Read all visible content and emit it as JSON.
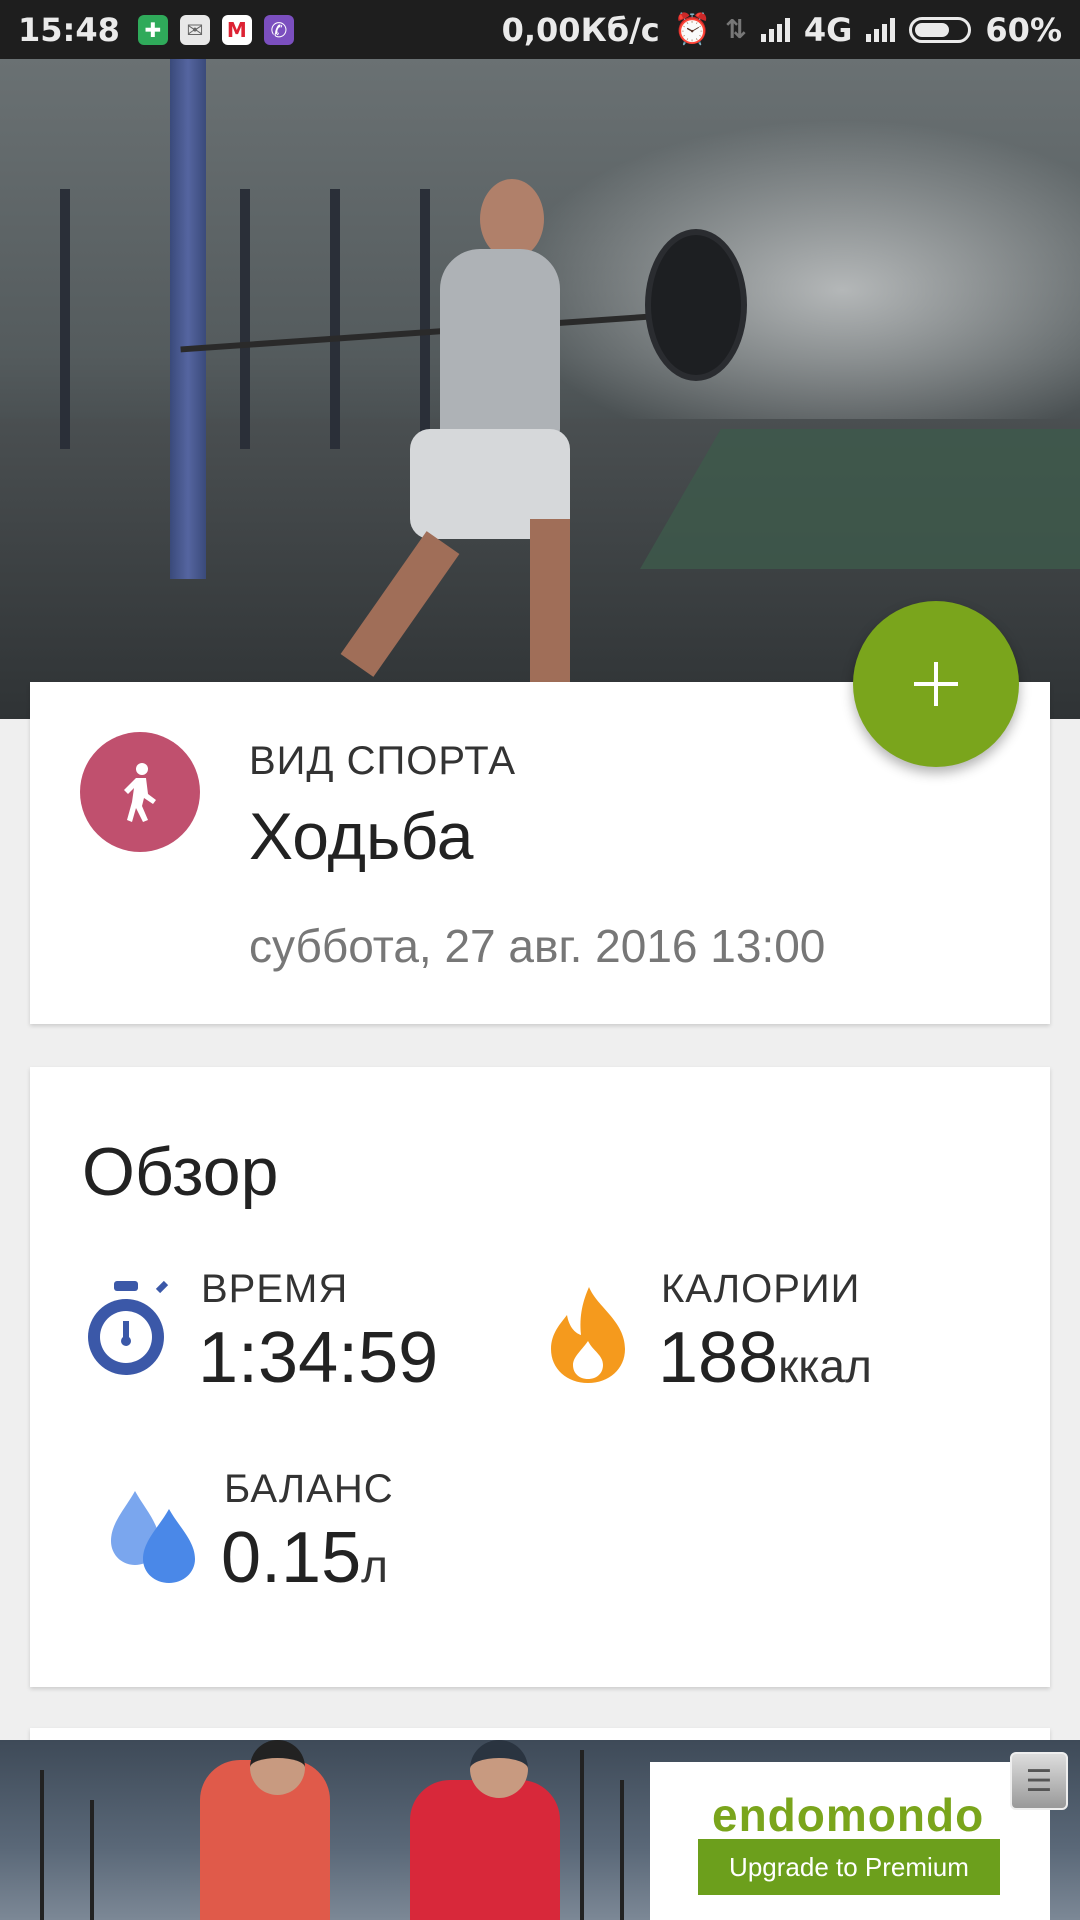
{
  "status_bar": {
    "time": "15:48",
    "network_speed": "0,00Кб/с",
    "network_type": "4G",
    "battery": "60%"
  },
  "fab": {
    "icon": "plus-icon"
  },
  "sport_card": {
    "label": "ВИД СПОРТА",
    "value": "Ходьба",
    "date": "суббота, 27 авг. 2016 13:00",
    "icon": "walking-icon",
    "icon_color": "#c0506e"
  },
  "overview": {
    "title": "Обзор",
    "time": {
      "label": "ВРЕМЯ",
      "value": "1:34:59",
      "icon": "stopwatch-icon",
      "color": "#3b58a8"
    },
    "calories": {
      "label": "КАЛОРИИ",
      "value": "188",
      "unit": "ккал",
      "icon": "flame-icon",
      "color": "#f59a1d"
    },
    "balance": {
      "label": "БАЛАНС",
      "value": "0.15",
      "unit": "л",
      "icon": "water-drops-icon",
      "color": "#4a88e8"
    }
  },
  "ad": {
    "brand": "endomondo",
    "button_label": "Upgrade to Premium"
  },
  "accent_color": "#7aa51c"
}
